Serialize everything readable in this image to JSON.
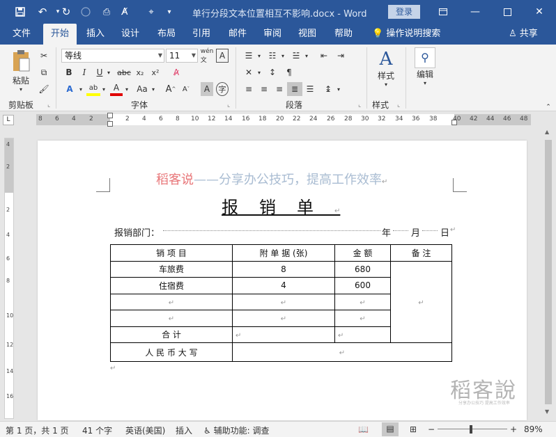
{
  "window": {
    "title": "单行分段文本位置相互不影响.docx  -  Word",
    "login_label": "登录"
  },
  "tabs": [
    "文件",
    "开始",
    "插入",
    "设计",
    "布局",
    "引用",
    "邮件",
    "审阅",
    "视图",
    "帮助"
  ],
  "tell_me": "操作说明搜索",
  "share": "共享",
  "ribbon": {
    "clipboard": {
      "paste": "粘贴",
      "label": "剪贴板"
    },
    "font": {
      "name": "等线",
      "size": "11",
      "label": "字体"
    },
    "paragraph": {
      "label": "段落"
    },
    "styles": {
      "button": "样式",
      "label": "样式"
    },
    "editing": {
      "button": "编辑"
    }
  },
  "ruler": {
    "h_numbers": [
      "8",
      "6",
      "4",
      "2",
      "2",
      "4",
      "6",
      "8",
      "10",
      "12",
      "14",
      "16",
      "18",
      "20",
      "22",
      "24",
      "26",
      "28",
      "30",
      "32",
      "34",
      "36",
      "38",
      "40",
      "42",
      "44",
      "46",
      "48"
    ],
    "v_numbers": [
      "4",
      "2",
      "2",
      "4",
      "6",
      "8",
      "10",
      "12",
      "14",
      "16"
    ]
  },
  "document": {
    "header_red": "稻客说",
    "header_rest": "——分享办公技巧，提高工作效率",
    "title": "报销单",
    "dept_label": "报销部门：",
    "date_year": "年",
    "date_month": "月",
    "date_day": "日",
    "table": {
      "headers": [
        "销 项 目",
        "附 单 据 (张)",
        "金 额",
        "备 注"
      ],
      "rows": [
        [
          "车旅费",
          "8",
          "680"
        ],
        [
          "住宿费",
          "4",
          "600"
        ],
        [
          "",
          "",
          ""
        ],
        [
          "",
          "",
          ""
        ]
      ],
      "total_label": "合 计",
      "rmb_label": "人 民 币 大 写"
    },
    "watermark": "稻客說",
    "watermark_sub": "分享办公技巧 提高工作效率"
  },
  "status": {
    "page": "第 1 页，共 1 页",
    "words": "41 个字",
    "language": "英语(美国)",
    "mode": "插入",
    "accessibility": "辅助功能: 调查",
    "zoom": "89%"
  }
}
